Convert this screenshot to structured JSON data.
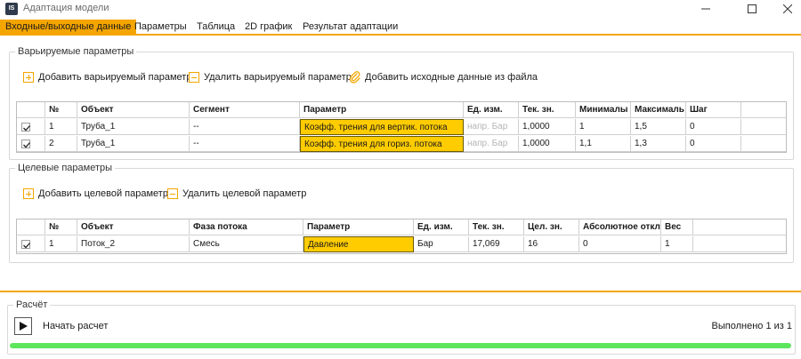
{
  "window": {
    "icon_text": "IS",
    "title": "Адаптация модели",
    "controls": {
      "minimize": "—",
      "maximize": "☐",
      "close": "✕"
    }
  },
  "tabs": [
    {
      "label": "Входные/выходные данные",
      "active": true
    },
    {
      "label": "Параметры"
    },
    {
      "label": "Таблица"
    },
    {
      "label": "2D график"
    },
    {
      "label": "Результат адаптации"
    }
  ],
  "varied": {
    "title": "Варьируемые параметры",
    "add_label": "Добавить варьируемый параметр",
    "remove_label": "Удалить варьируемый параметр",
    "add_file_label": "Добавить исходные данные из файла",
    "columns": [
      "№",
      "Объект",
      "Сегмент",
      "Параметр",
      "Ед. изм.",
      "Тек. зн.",
      "Минималы",
      "Максималь",
      "Шаг"
    ],
    "rows": [
      {
        "checked": true,
        "num": "1",
        "object": "Труба_1",
        "segment": "--",
        "param": "Коэфф. трения для вертик. потока",
        "unit": "напр. Бар",
        "cur": "1,0000",
        "min": "1",
        "max": "1,5",
        "step": "0"
      },
      {
        "checked": true,
        "num": "2",
        "object": "Труба_1",
        "segment": "--",
        "param": "Коэфф. трения для гориз. потока",
        "unit": "напр. Бар",
        "cur": "1,0000",
        "min": "1,1",
        "max": "1,3",
        "step": "0"
      }
    ]
  },
  "target": {
    "title": "Целевые параметры",
    "add_label": "Добавить целевой параметр",
    "remove_label": "Удалить целевой параметр",
    "columns": [
      "№",
      "Объект",
      "Фаза потока",
      "Параметр",
      "Ед. изм.",
      "Тек. зн.",
      "Цел. зн.",
      "Абсолютное откл",
      "Вес"
    ],
    "rows": [
      {
        "checked": true,
        "num": "1",
        "object": "Поток_2",
        "phase": "Смесь",
        "param": "Давление",
        "unit": "Бар",
        "cur": "17,069",
        "target": "16",
        "abs": "0",
        "weight": "1"
      }
    ]
  },
  "calc": {
    "title": "Расчёт",
    "start_label": "Начать расчет",
    "status": "Выполнено 1 из 1",
    "progress": 1.0
  },
  "colors": {
    "accent": "#f5a500",
    "highlight": "#ffcc00",
    "progress": "#5ce65c"
  }
}
